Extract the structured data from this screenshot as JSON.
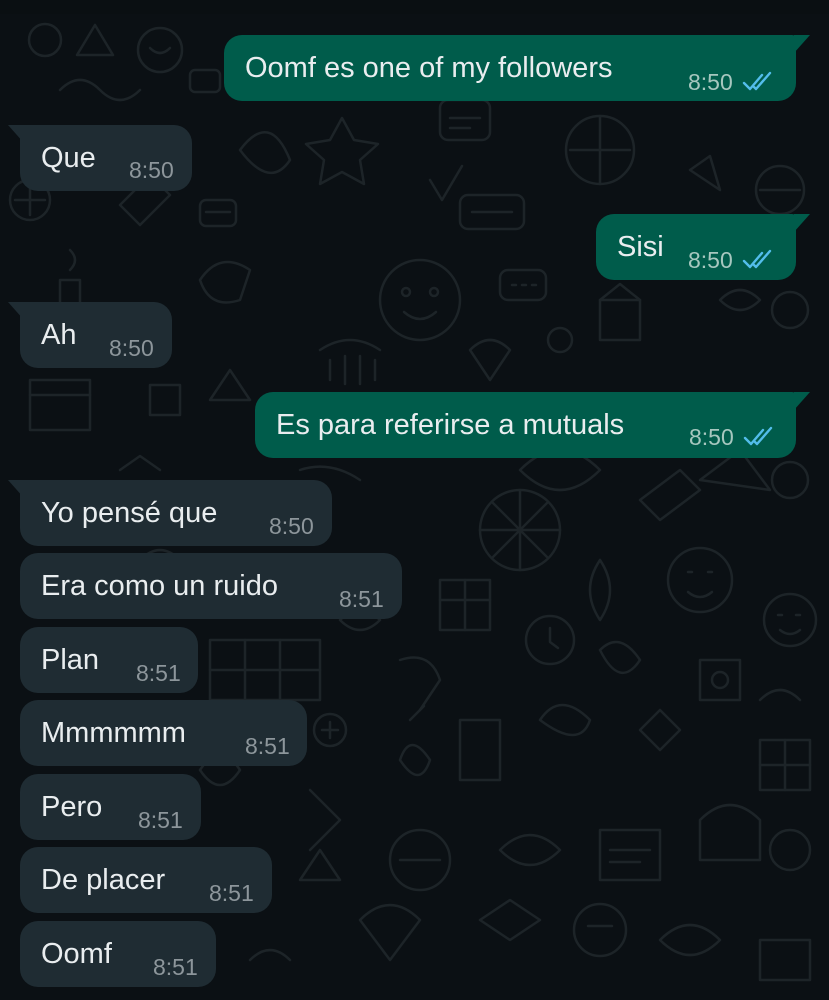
{
  "colors": {
    "background": "#0b1014",
    "incoming_bubble": "#1f2c33",
    "outgoing_bubble": "#005c4b",
    "text": "#e9edef",
    "timestamp": "#8d969b",
    "read_ticks": "#53bdeb"
  },
  "messages": [
    {
      "direction": "outgoing",
      "text": "Oomf es one of my followers",
      "time": "8:50",
      "status": "read",
      "status_icon": "double-check-icon"
    },
    {
      "direction": "incoming",
      "text": "Que",
      "time": "8:50"
    },
    {
      "direction": "outgoing",
      "text": "Sisi",
      "time": "8:50",
      "status": "read",
      "status_icon": "double-check-icon"
    },
    {
      "direction": "incoming",
      "text": "Ah",
      "time": "8:50"
    },
    {
      "direction": "outgoing",
      "text": "Es para referirse a mutuals",
      "time": "8:50",
      "status": "read",
      "status_icon": "double-check-icon"
    },
    {
      "direction": "incoming",
      "text": "Yo pensé que",
      "time": "8:50"
    },
    {
      "direction": "incoming",
      "text": "Era como un ruido",
      "time": "8:51"
    },
    {
      "direction": "incoming",
      "text": "Plan",
      "time": "8:51"
    },
    {
      "direction": "incoming",
      "text": "Mmmmmm",
      "time": "8:51"
    },
    {
      "direction": "incoming",
      "text": "Pero",
      "time": "8:51"
    },
    {
      "direction": "incoming",
      "text": "De placer",
      "time": "8:51"
    },
    {
      "direction": "incoming",
      "text": "Oomf",
      "time": "8:51"
    }
  ]
}
